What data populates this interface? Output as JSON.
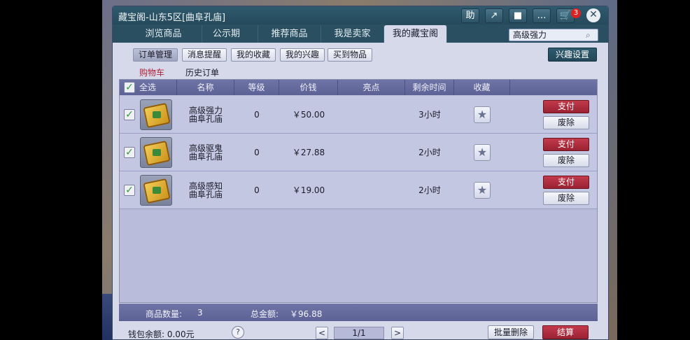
{
  "window": {
    "title": "藏宝阁-山东5区[曲阜孔庙]"
  },
  "titlebar_buttons": [
    {
      "icon": "help-icon",
      "label": "助"
    },
    {
      "icon": "share-arrow-icon",
      "label": "↗"
    },
    {
      "icon": "stop-icon",
      "label": "■"
    },
    {
      "icon": "chat-bubble-icon",
      "label": "…"
    },
    {
      "icon": "cart-icon",
      "label": "🛒"
    }
  ],
  "cart_count": "3",
  "close_label": "✕",
  "tabs": [
    {
      "label": "浏览商品"
    },
    {
      "label": "公示期"
    },
    {
      "label": "推荐商品"
    },
    {
      "label": "我是卖家"
    },
    {
      "label": "我的藏宝阁"
    }
  ],
  "search": {
    "value": "高级强力",
    "icon": "search-icon"
  },
  "subnav": [
    {
      "label": "订单管理"
    },
    {
      "label": "消息提醒"
    },
    {
      "label": "我的收藏"
    },
    {
      "label": "我的兴趣"
    },
    {
      "label": "买到物品"
    }
  ],
  "interest_settings": "兴趣设置",
  "cart_links": {
    "cart": "购物车",
    "history": "历史订单"
  },
  "table": {
    "headers": [
      "全选",
      "名称",
      "等级",
      "价钱",
      "亮点",
      "剩余时间",
      "收藏"
    ],
    "check_mark": "✓",
    "rows": [
      {
        "name_line1": "高级强力",
        "name_line2": "曲阜孔庙",
        "level": "0",
        "price": "￥50.00",
        "time": "3小时"
      },
      {
        "name_line1": "高级驱鬼",
        "name_line2": "曲阜孔庙",
        "level": "0",
        "price": "￥27.88",
        "time": "2小时"
      },
      {
        "name_line1": "高级感知",
        "name_line2": "曲阜孔庙",
        "level": "0",
        "price": "￥19.00",
        "time": "2小时"
      }
    ],
    "pay_label": "支付",
    "remove_label": "废除",
    "fav_icon": "★"
  },
  "summary": {
    "count_label": "商品数量:",
    "count": "3",
    "total_label": "总金额:",
    "total": "￥96.88"
  },
  "footer": {
    "wallet_label": "钱包余额: 0.00元",
    "help": "?",
    "prev": "<",
    "page": "1/1",
    "next": ">",
    "batch_delete": "批量删除",
    "checkout": "结算"
  }
}
